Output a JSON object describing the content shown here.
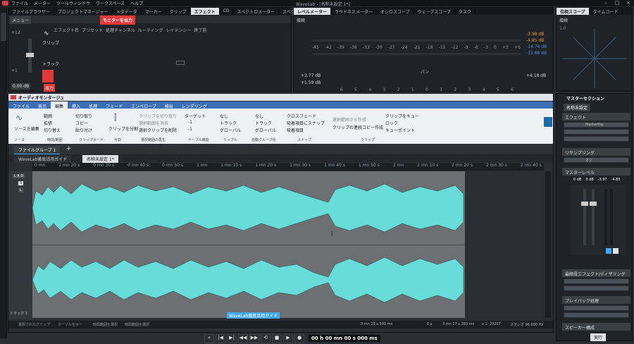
{
  "app": {
    "title": "WaveLab - [名称未設定 1*]",
    "menu": [
      "ファイル",
      "メーター",
      "ツールウィンドウ",
      "ワークスペース",
      "ヘルプ"
    ]
  },
  "top_left_tabs": [
    "ファイルブラウザー",
    "プロジェクトマネージャー",
    "メタデータ",
    "マーカー",
    "クリップ",
    "エフェクト",
    "CD",
    "スペクトロメーター",
    "スペクトロスコープ"
  ],
  "top_left_active_tab": "エフェクト",
  "effects_panel": {
    "menu_label": "メニュー",
    "monitor_button": "モニターを出力",
    "columns": [
      "エフェクト名",
      "プリセット",
      "処理チャンネル",
      "ルーティング",
      "レイテンシー",
      "終了前"
    ],
    "gain_value": "0.00 dB",
    "scale_top": "+12",
    "scale_bottom": "+1",
    "clip_label": "クリップ",
    "track_label": "トラック",
    "output_label": "出力"
  },
  "level_meter": {
    "tabs": [
      "レベルメーター",
      "ラウドネスメーター",
      "オシロスコープ",
      "ウェーブスコープ",
      "タスク"
    ],
    "top_label": "接続",
    "scale": [
      "-45",
      "-42",
      "-39",
      "-36",
      "-33",
      "-30",
      "-27",
      "-24",
      "-21",
      "-18",
      "-15",
      "-12",
      "-9",
      "-6",
      "-3",
      "0",
      "+3",
      "+6"
    ],
    "right_values": [
      "-3.98 dB",
      "-4.85 dB",
      "-14.74 dB",
      "-15.88 dB"
    ],
    "pan_label": "パン",
    "left_pan": [
      "+3.77 dB",
      "+1.59 dB"
    ],
    "right_pan": "+4.18 dB",
    "bottom_scale": [
      "6",
      "5",
      "4",
      "3",
      "2",
      "1",
      "0",
      "1",
      "2",
      "3",
      "4",
      "5",
      "6"
    ]
  },
  "phase_scope": {
    "tabs": [
      "位相スコープ",
      "タイムコード"
    ],
    "label": "接続",
    "scale": "1.0"
  },
  "audio_montage": {
    "title": "オーディオモンタージュ",
    "ribbon_tabs": [
      "ファイル",
      "表示",
      "編集",
      "挿入",
      "処理",
      "フェード",
      "エンベロープ",
      "検出",
      "レンダリング"
    ],
    "active_tab": "編集",
    "source_edit": "ソースを編集",
    "edit_cut": "切り取り",
    "edit_copy": "コピー",
    "edit_paste": "貼り付け",
    "range": "範囲",
    "expand": "拡張",
    "switch": "切り替え",
    "split": "クリップを分割",
    "clip_cut": "クリップを切り取り",
    "sel_delete": "選択範囲を消去",
    "sel_clip_delete": "選択クリップを削除",
    "target": "ターゲット",
    "minus1": "-1",
    "minus1b": "-1",
    "none1": "なし",
    "track1": "トラック",
    "global1": "グローバル",
    "none2": "なし",
    "track2": "トラック",
    "global2": "グローバル",
    "crossfade": "クロスフェード",
    "snap_cursor": "吸着項目にスナップ",
    "snap_item": "吸着項目",
    "sel_range_create": "選択範囲から作成",
    "clip_copy": "クリップの連続コピー作成",
    "clip_cue": "クリップをキュー",
    "lock": "ロック",
    "cue_point": "キューポイント",
    "groups": [
      "ソース",
      "時間/範囲",
      "クリップボード",
      "分割",
      "選択範囲の再生",
      "テーブル機能",
      "リップル",
      "自動グループ化",
      "スナップ",
      "クリップ"
    ],
    "file_group_tab": "ファイルグループ 1",
    "file_tabs": [
      "WaveLab徹底活用ガイド",
      "名称未設定 1*"
    ],
    "active_file": "名称未設定 1*",
    "track_badges": [
      "L R D",
      "S",
      "L",
      "トラック 1"
    ],
    "clip_label": "WaveLab徹底活用ガイド",
    "ruler": [
      "0 mn",
      "1 mn 20 s",
      "0 mn 30 s",
      "0 mn 40 s",
      "0 mn 50 s",
      "1 mn",
      "1 mn 10 s",
      "1 mn 20 s",
      "1 mn 30 s",
      "1 mn 40 s",
      "1 mn 50 s",
      "2 mn",
      "2 mn 10 s",
      "2 mn 20 s",
      "2 mn 30 s",
      "2 mn 40 s"
    ],
    "status": {
      "left": [
        "選択されたクリップ",
        "カーソルをキー",
        "時間範囲を選択",
        "時間範囲を選択"
      ],
      "length": "3 mn 29 s 500 ms",
      "pos": "0 s",
      "dur": "3 mn 17 s 283 ms",
      "zoom": "x 1: 23207",
      "rate": "ステレオ 96 000 Hz"
    }
  },
  "transport": {
    "time": "00 h 00 mn 00 s 000 ms"
  },
  "master_section": {
    "title": "マスターセクション",
    "preset": "名称未設定",
    "effect_label": "エフェクト",
    "effect_slot": "MasterRig",
    "sampling": "リサンプリング",
    "sampling_val": "オフ",
    "level_label": "マスターレベル",
    "levels": [
      "0 dB",
      "0 dB",
      "-3.97",
      "-4.85"
    ],
    "final": "最終段エフェクト/ディザリング",
    "playback": "プレイバック処理",
    "speaker": "スピーカー構成",
    "render": "実行"
  },
  "colors": {
    "accent": "#3fa9f5",
    "wave": "#67dcd8",
    "wave_dark": "#1f4a4c",
    "monitor_red": "#e23a3a",
    "ribbon_blue": "#4a90d9"
  }
}
